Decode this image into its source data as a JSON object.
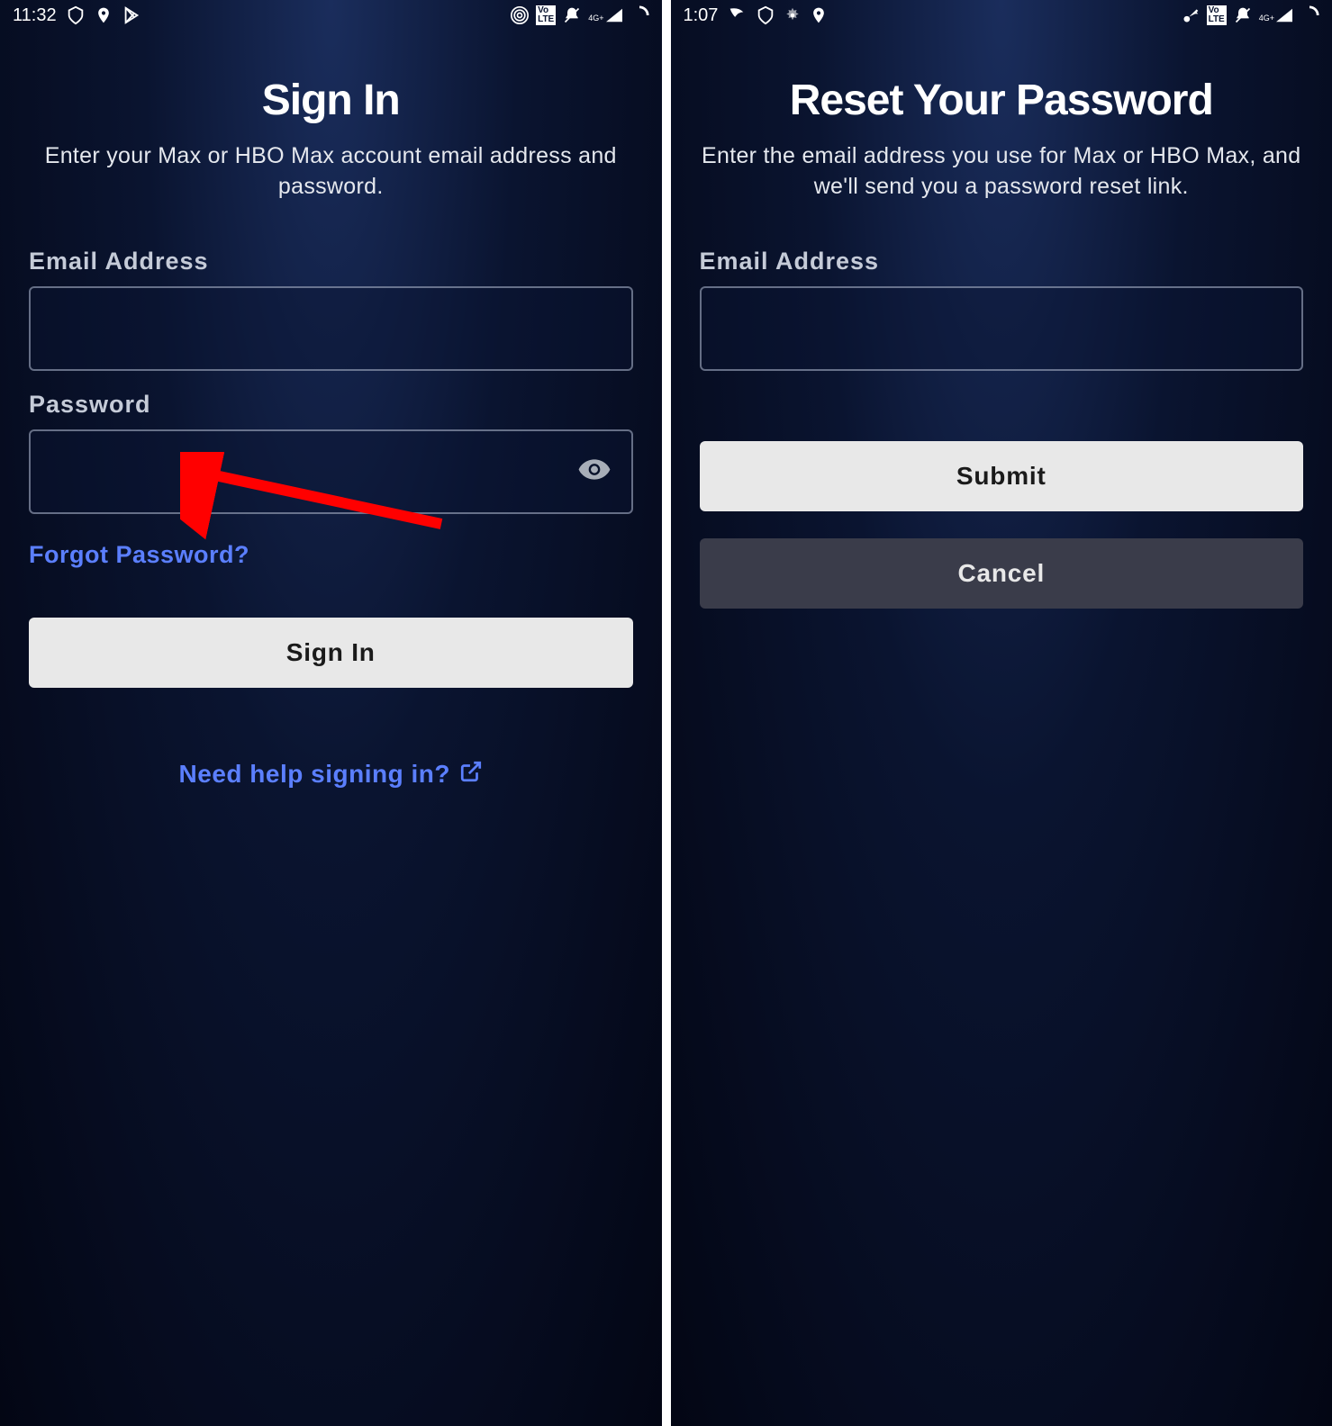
{
  "leftScreen": {
    "statusBar": {
      "time": "11:32"
    },
    "title": "Sign In",
    "subtitle": "Enter your Max or HBO Max account email address and password.",
    "emailLabel": "Email Address",
    "passwordLabel": "Password",
    "forgotLink": "Forgot Password?",
    "signInButton": "Sign In",
    "helpLink": "Need help signing in?"
  },
  "rightScreen": {
    "statusBar": {
      "time": "1:07"
    },
    "title": "Reset Your Password",
    "subtitle": "Enter the email address you use for Max or HBO Max, and we'll send you a password reset link.",
    "emailLabel": "Email Address",
    "submitButton": "Submit",
    "cancelButton": "Cancel"
  }
}
